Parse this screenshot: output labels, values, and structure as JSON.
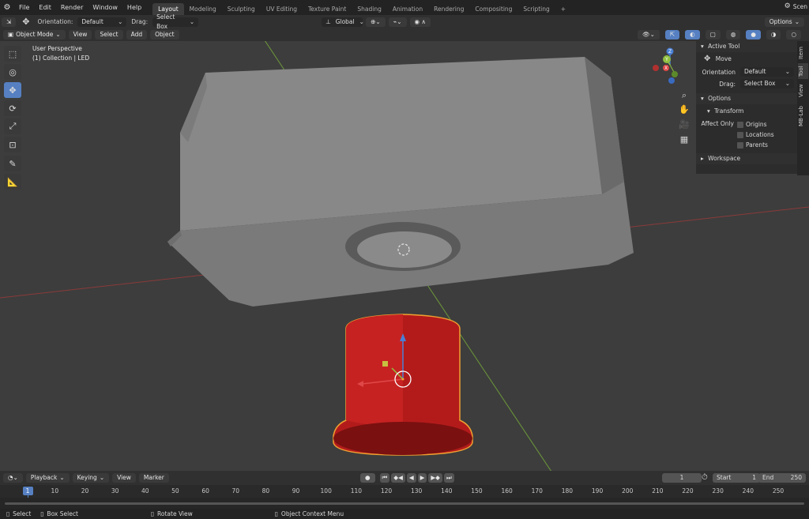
{
  "topbar": {
    "menus": [
      "File",
      "Edit",
      "Render",
      "Window",
      "Help"
    ],
    "workspaces": [
      "Layout",
      "Modeling",
      "Sculpting",
      "UV Editing",
      "Texture Paint",
      "Shading",
      "Animation",
      "Rendering",
      "Compositing",
      "Scripting"
    ],
    "active_workspace": "Layout",
    "add_tab": "+",
    "scene_label": "Scen"
  },
  "toolheader": {
    "orientation_label": "Orientation:",
    "orientation_value": "Default",
    "drag_label": "Drag:",
    "drag_value": "Select Box",
    "transform_space": "Global",
    "options_label": "Options"
  },
  "viewheader": {
    "mode": "Object Mode",
    "menus": [
      "View",
      "Select",
      "Add",
      "Object"
    ]
  },
  "viewport": {
    "perspective_label": "User Perspective",
    "collection_label": "(1) Collection | LED",
    "axes": {
      "x": "X",
      "y": "Y",
      "z": "Z"
    }
  },
  "npanel": {
    "active_tool_title": "Active Tool",
    "tool_name": "Move",
    "orientation_label": "Orientation",
    "orientation_value": "Default",
    "drag_label": "Drag:",
    "drag_value": "Select Box",
    "options_title": "Options",
    "transform_title": "Transform",
    "affect_only_label": "Affect Only",
    "affect_options": [
      "Origins",
      "Locations",
      "Parents"
    ],
    "workspace_title": "Workspace",
    "side_tabs": [
      "Item",
      "Tool",
      "View",
      "MB-Lab"
    ]
  },
  "timeline": {
    "menus": [
      "Playback",
      "Keying",
      "View",
      "Marker"
    ],
    "current_frame": "1",
    "start_label": "Start",
    "start_value": "1",
    "end_label": "End",
    "end_value": "250",
    "ticks": [
      "1",
      "10",
      "20",
      "30",
      "40",
      "50",
      "60",
      "70",
      "80",
      "90",
      "100",
      "110",
      "120",
      "130",
      "140",
      "150",
      "160",
      "170",
      "180",
      "190",
      "200",
      "210",
      "220",
      "230",
      "240",
      "250"
    ]
  },
  "statusbar": {
    "items": [
      "Select",
      "Box Select",
      "Rotate View",
      "Object Context Menu"
    ]
  },
  "colors": {
    "accent": "#5680c2",
    "led_red": "#b31b1b",
    "selection_outline": "#f0a030"
  }
}
